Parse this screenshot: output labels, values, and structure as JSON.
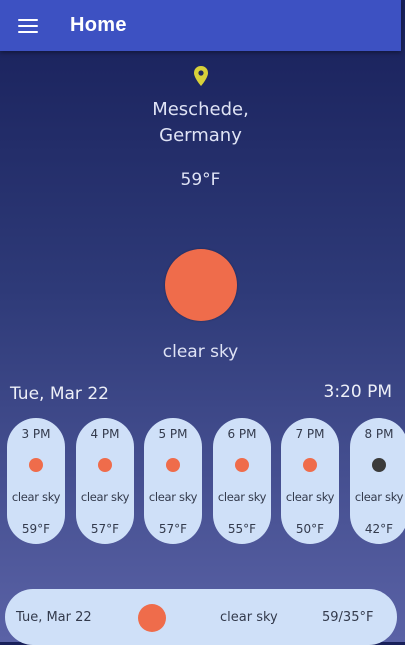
{
  "appbar": {
    "title": "Home",
    "menu_icon": "hamburger-menu-icon"
  },
  "location": {
    "icon": "location-pin-icon",
    "city": "Meschede,",
    "country": "Germany"
  },
  "current": {
    "temperature": "59°F",
    "condition": "clear sky",
    "date": "Tue, Mar 22",
    "time": "3:20 PM",
    "icon_color": "#ef6c4b"
  },
  "hourly": [
    {
      "time": "3 PM",
      "condition": "clear sky",
      "temp": "59°F",
      "color": "#ef6c4b"
    },
    {
      "time": "4 PM",
      "condition": "clear sky",
      "temp": "57°F",
      "color": "#ef6c4b"
    },
    {
      "time": "5 PM",
      "condition": "clear sky",
      "temp": "57°F",
      "color": "#ef6c4b"
    },
    {
      "time": "6 PM",
      "condition": "clear sky",
      "temp": "55°F",
      "color": "#ef6c4b"
    },
    {
      "time": "7 PM",
      "condition": "clear sky",
      "temp": "50°F",
      "color": "#ef6c4b"
    },
    {
      "time": "8 PM",
      "condition": "clear sky",
      "temp": "42°F",
      "color": "#3b3b3b"
    }
  ],
  "daily": [
    {
      "date": "Tue, Mar 22",
      "condition": "clear sky",
      "range": "59/35°F",
      "color": "#ef6c4b"
    }
  ],
  "colors": {
    "appbar": "#3d51c2",
    "card": "#cfe0f8",
    "sun": "#ef6c4b",
    "moon": "#3b3b3b"
  }
}
